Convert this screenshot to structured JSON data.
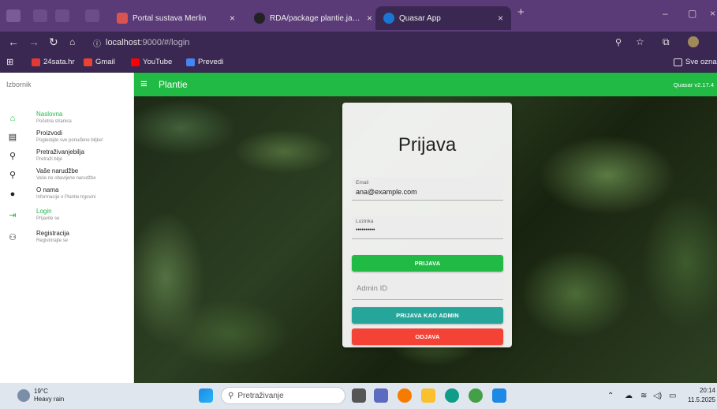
{
  "browser": {
    "tabs": [
      {
        "title": "Portal sustava Merlin",
        "active": false
      },
      {
        "title": "RDA/package plantie.java at m",
        "active": false
      },
      {
        "title": "Quasar App",
        "active": true
      }
    ],
    "url_host": "localhost",
    "url_path": ":9000/#/login",
    "bookmarks": [
      "24sata.hr",
      "Gmail",
      "YouTube",
      "Prevedi"
    ],
    "bookmarks_right": "Sve oznak"
  },
  "drawer": {
    "heading": "Izbornik",
    "items": [
      {
        "label": "Naslovna",
        "sub": "Početna stranica",
        "icon": "home-icon",
        "glyph": "⌂",
        "active": true
      },
      {
        "label": "Proizvodi",
        "sub": "Pogledajte sve ponuđene biljke!",
        "icon": "products-icon",
        "glyph": "▤",
        "active": false
      },
      {
        "label": "Pretraživanjebilja",
        "sub": "Pretraži bilje",
        "icon": "search-icon",
        "glyph": "⚲",
        "active": false
      },
      {
        "label": "Vaše narudžbe",
        "sub": "Vaše ne obavljene narudžbe",
        "icon": "orders-search-icon",
        "glyph": "⚲",
        "active": false
      },
      {
        "label": "O nama",
        "sub": "Informacije o Plantie trgovini",
        "icon": "info-icon",
        "glyph": "●",
        "active": false
      },
      {
        "label": "Login",
        "sub": "Prijavite se",
        "icon": "login-icon",
        "glyph": "⇥",
        "active": true
      },
      {
        "label": "Registracija",
        "sub": "Registrirajte se",
        "icon": "register-icon",
        "glyph": "⚇",
        "active": false
      }
    ]
  },
  "header": {
    "title": "Plantie",
    "version": "Quasar v2.17.4"
  },
  "login": {
    "heading": "Prijava",
    "email_label": "Email",
    "email_value": "ana@example.com",
    "password_label": "Lozinka",
    "password_value": "••••••••••",
    "login_button": "PRIJAVA",
    "admin_placeholder": "Admin ID",
    "admin_button": "PRIJAVA KAO ADMIN",
    "logout_button": "ODJAVA"
  },
  "taskbar": {
    "temp": "19°C",
    "weather": "Heavy rain",
    "search_placeholder": "Pretraživanje",
    "time": "20:14",
    "date": "11.5.2025"
  },
  "colors": {
    "primary": "#21ba45",
    "secondary": "#26a69a",
    "negative": "#f44336",
    "browser": "#5b3a78"
  }
}
